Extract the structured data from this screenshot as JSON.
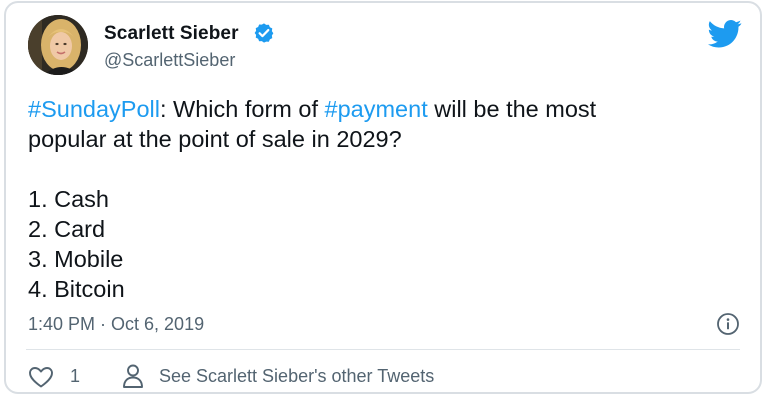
{
  "author": {
    "name": "Scarlett Sieber",
    "handle": "@ScarlettSieber",
    "verified": true
  },
  "tweet": {
    "line1": [
      {
        "text": "#SundayPoll",
        "type": "hashtag"
      },
      {
        "text": ": Which form of ",
        "type": "text"
      },
      {
        "text": "#payment",
        "type": "hashtag"
      },
      {
        "text": " will be the most",
        "type": "text"
      }
    ],
    "line2": "popular at the point of sale in 2029?",
    "options": [
      "1. Cash",
      "2. Card",
      "3. Mobile",
      "4. Bitcoin"
    ],
    "timestamp": "1:40 PM · Oct 6, 2019"
  },
  "footer": {
    "like_count": "1",
    "other_tweets_label": "See Scarlett Sieber's other Tweets"
  },
  "icons": {
    "brand": "twitter-logo-icon",
    "verified": "verified-badge-icon",
    "info": "info-icon",
    "like": "heart-icon",
    "profile": "person-icon"
  },
  "colors": {
    "accent": "#1d9bf0",
    "text": "#0f1419",
    "secondary_text": "#536471",
    "border": "#d9dee3"
  }
}
